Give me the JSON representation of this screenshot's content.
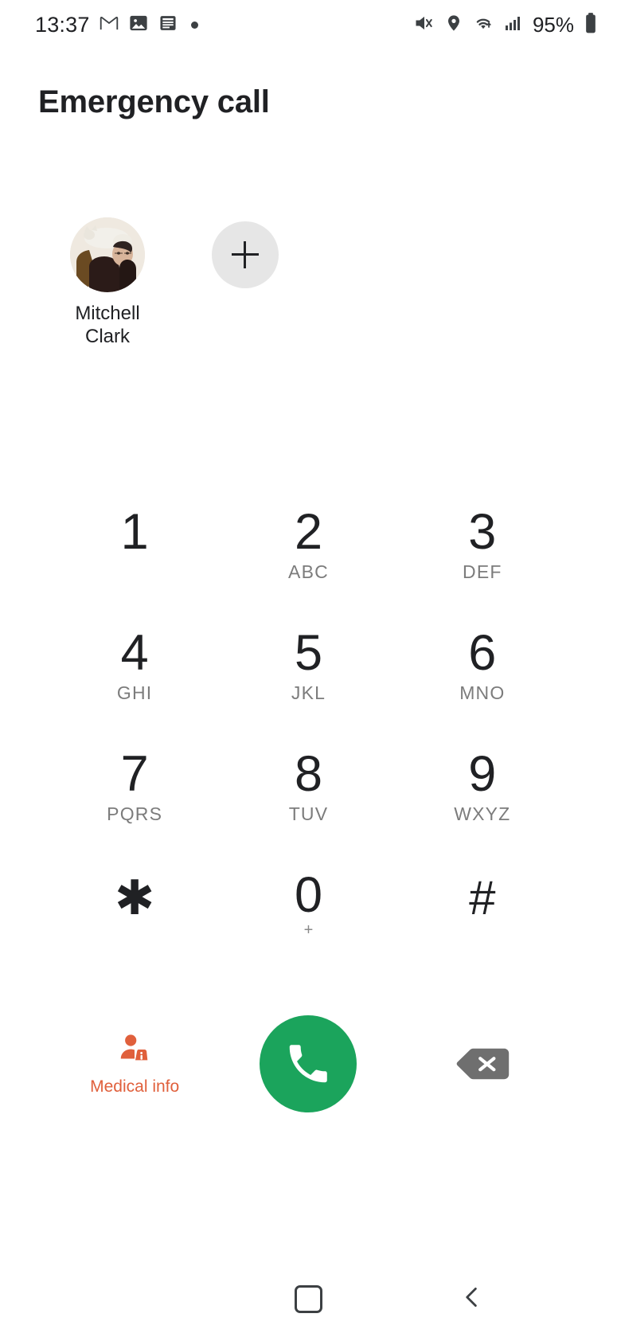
{
  "status_bar": {
    "time": "13:37",
    "battery_percent": "95%",
    "left_icons": [
      "gmail-icon",
      "photos-icon",
      "news-article-icon",
      "notification-dot-icon"
    ],
    "right_icons": [
      "mute-icon",
      "location-pin-icon",
      "wifi-icon",
      "cellular-signal-icon",
      "battery-icon"
    ]
  },
  "header": {
    "title": "Emergency call"
  },
  "contacts": {
    "items": [
      {
        "name": "Mitchell Clark",
        "avatar": "contact-photo"
      }
    ],
    "add_label": "+"
  },
  "keypad": {
    "keys": [
      {
        "digit": "1",
        "letters": ""
      },
      {
        "digit": "2",
        "letters": "ABC"
      },
      {
        "digit": "3",
        "letters": "DEF"
      },
      {
        "digit": "4",
        "letters": "GHI"
      },
      {
        "digit": "5",
        "letters": "JKL"
      },
      {
        "digit": "6",
        "letters": "MNO"
      },
      {
        "digit": "7",
        "letters": "PQRS"
      },
      {
        "digit": "8",
        "letters": "TUV"
      },
      {
        "digit": "9",
        "letters": "WXYZ"
      },
      {
        "digit": "✱",
        "letters": ""
      },
      {
        "digit": "0",
        "letters": "+"
      },
      {
        "digit": "#",
        "letters": ""
      }
    ]
  },
  "actions": {
    "medical_info_label": "Medical info",
    "call_button": "call-button",
    "delete_button": "backspace-button"
  },
  "nav_bar": {
    "home": "home-button",
    "back": "back-button"
  },
  "colors": {
    "call_green": "#1ba45c",
    "medical_orange": "#e0603c",
    "delete_gray": "#6f6f6f",
    "add_button_gray": "#e6e6e6",
    "text_primary": "#202124",
    "text_secondary": "#7c7c7c"
  }
}
